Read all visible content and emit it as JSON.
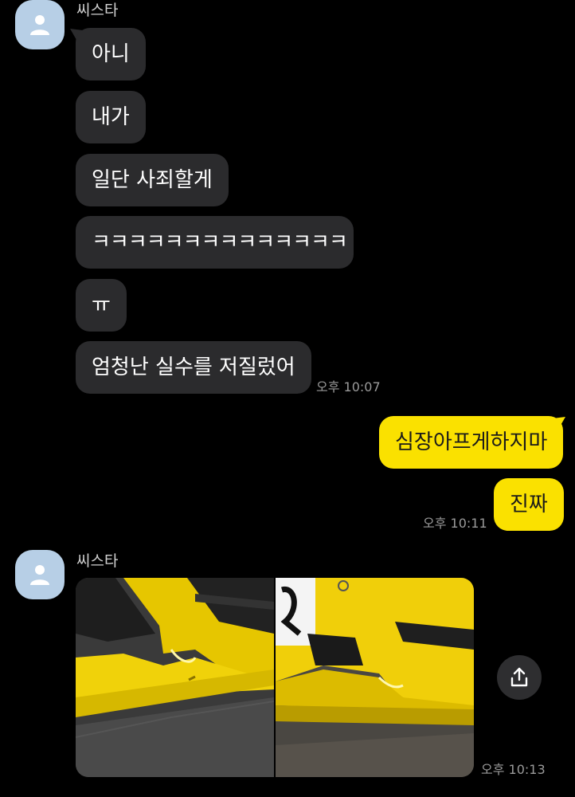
{
  "contact": {
    "name": "씨스타",
    "avatar_icon": "person-icon",
    "avatar_color": "#b7cfe6"
  },
  "messages_in_1": [
    "아니",
    "내가",
    "일단 사죄할게",
    "ㅋㅋㅋㅋㅋㅋㅋㅋㅋㅋㅋㅋㅋㅋ",
    "ㅠ",
    "엄청난 실수를 저질렀어"
  ],
  "time_in_1": "오후 10:07",
  "messages_out": [
    "심장아프게하지마",
    "진짜"
  ],
  "time_out": "오후 10:11",
  "time_in_2": "오후 10:13",
  "share_icon": "share-icon",
  "colors": {
    "incoming_bubble": "#2b2b2d",
    "outgoing_bubble": "#fae100",
    "background": "#000000"
  }
}
